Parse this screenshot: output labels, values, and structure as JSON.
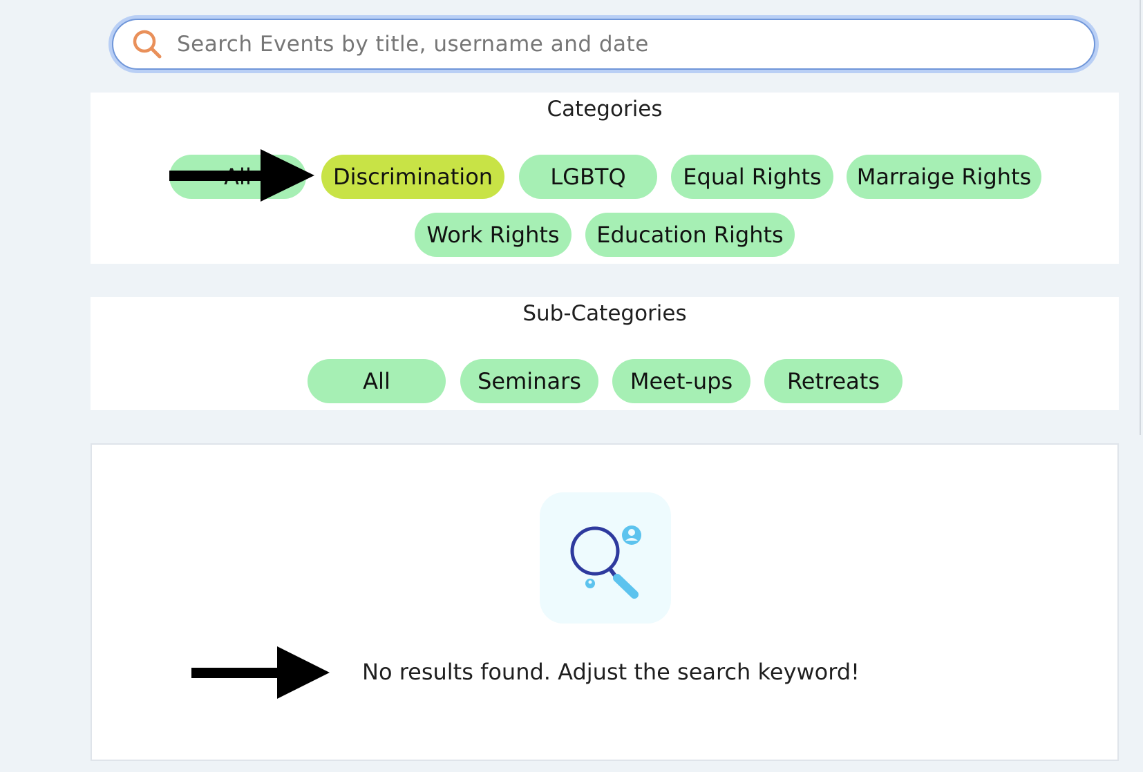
{
  "search": {
    "placeholder": "Search Events by title, username and date",
    "value": "",
    "icon": "search-icon",
    "icon_color": "#e9905a"
  },
  "categories": {
    "title": "Categories",
    "items": [
      {
        "label": "All",
        "active": false
      },
      {
        "label": "Discrimination",
        "active": true
      },
      {
        "label": "LGBTQ",
        "active": false
      },
      {
        "label": "Equal Rights",
        "active": false
      },
      {
        "label": "Marraige Rights",
        "active": false
      },
      {
        "label": "Work Rights",
        "active": false
      },
      {
        "label": "Education Rights",
        "active": false
      }
    ]
  },
  "subcategories": {
    "title": "Sub-Categories",
    "items": [
      {
        "label": "All",
        "active": false
      },
      {
        "label": "Seminars",
        "active": false
      },
      {
        "label": "Meet-ups",
        "active": false
      },
      {
        "label": "Retreats",
        "active": false
      }
    ]
  },
  "results": {
    "empty_message": "No results found. Adjust the search keyword!",
    "empty_icon": "magnifier-people-icon"
  },
  "annotations": {
    "arrow_icon": "arrow-right-icon"
  },
  "colors": {
    "chip": "#a6efb4",
    "chip_active": "#c8e346",
    "background": "#eef3f7",
    "search_ring": "#b9cff5"
  }
}
